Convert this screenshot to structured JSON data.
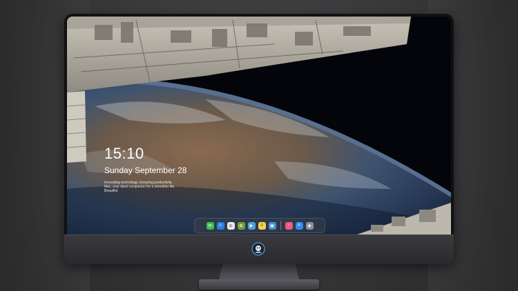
{
  "clock": {
    "time": "15:10",
    "date": "Sunday September 28",
    "tagline": "Innovating technology. Ensuring productivity. Mac, your ideal companion for a smoother life. Beautiful"
  },
  "dock": {
    "apps": [
      {
        "name": "messages-icon",
        "glyph": "✉",
        "color": "#36c24a"
      },
      {
        "name": "finder-icon",
        "glyph": "☺",
        "color": "#2f7de1"
      },
      {
        "name": "safari-icon",
        "glyph": "◎",
        "color": "#e9e9ee"
      },
      {
        "name": "photos-icon",
        "glyph": "✿",
        "color": "#6f9e3a"
      },
      {
        "name": "video-editor-icon",
        "glyph": "▶",
        "color": "#4aa3d9"
      },
      {
        "name": "notes-icon",
        "glyph": "≡",
        "color": "#f4d34a"
      },
      {
        "name": "preview-icon",
        "glyph": "▣",
        "color": "#4a8fd4"
      },
      {
        "name": "music-icon",
        "glyph": "♪",
        "color": "#f0587e"
      },
      {
        "name": "app-store-icon",
        "glyph": "A",
        "color": "#2f8cf0"
      },
      {
        "name": "camera-icon",
        "glyph": "◉",
        "color": "#8a8f99"
      }
    ]
  },
  "colors": {
    "bezel": "#111111",
    "chin": "#2f2f33",
    "accent": "#4fb3ff"
  }
}
